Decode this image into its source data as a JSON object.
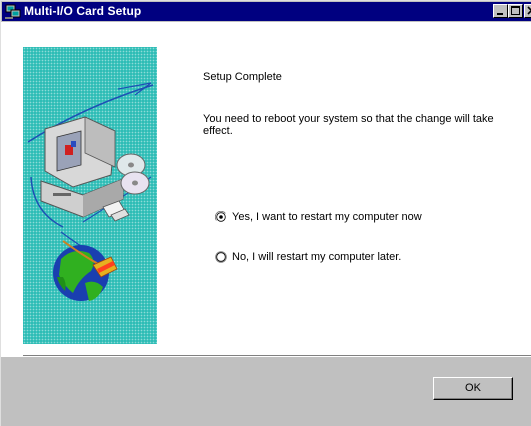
{
  "window": {
    "title": "Multi-I/O Card Setup"
  },
  "titlebar_buttons": {
    "minimize_icon": "minimize-icon",
    "maximize_icon": "maximize-icon",
    "close_icon": "close-icon"
  },
  "content": {
    "heading": "Setup Complete",
    "message": "You need to reboot your system so that the change will take effect."
  },
  "options": [
    {
      "label": "Yes, I want to restart my computer now",
      "selected": true
    },
    {
      "label": "No, I will restart my computer later.",
      "selected": false
    }
  ],
  "buttons": {
    "ok_label": "OK"
  },
  "colors": {
    "titlebar": "#000080",
    "dialog_face": "#c0c0c0",
    "illustration_bg": "#2ebdb6"
  }
}
